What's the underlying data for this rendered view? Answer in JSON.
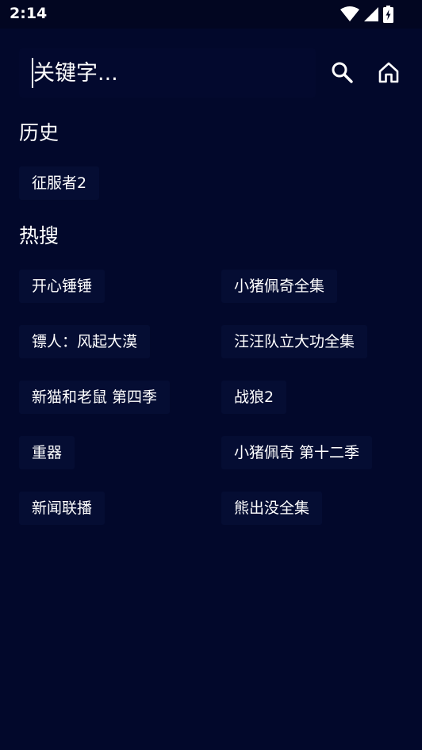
{
  "status_bar": {
    "time": "2:14",
    "icons": [
      "wifi-icon",
      "signal-icon",
      "battery-charging-icon"
    ]
  },
  "search": {
    "placeholder": "关键字..."
  },
  "toolbar": {
    "icons": [
      "search-icon",
      "home-icon"
    ]
  },
  "history": {
    "title": "历史",
    "items": [
      "征服者2"
    ]
  },
  "hot": {
    "title": "热搜",
    "items": [
      "开心锤锤",
      "小猪佩奇全集",
      "镖人：风起大漠",
      "汪汪队立大功全集",
      "新猫和老鼠 第四季",
      "战狼2",
      "重器",
      "小猪佩奇 第十二季",
      "新闻联播",
      "熊出没全集"
    ]
  },
  "colors": {
    "background": "#02082b",
    "chip": "#050d33",
    "text": "#ffffff"
  }
}
